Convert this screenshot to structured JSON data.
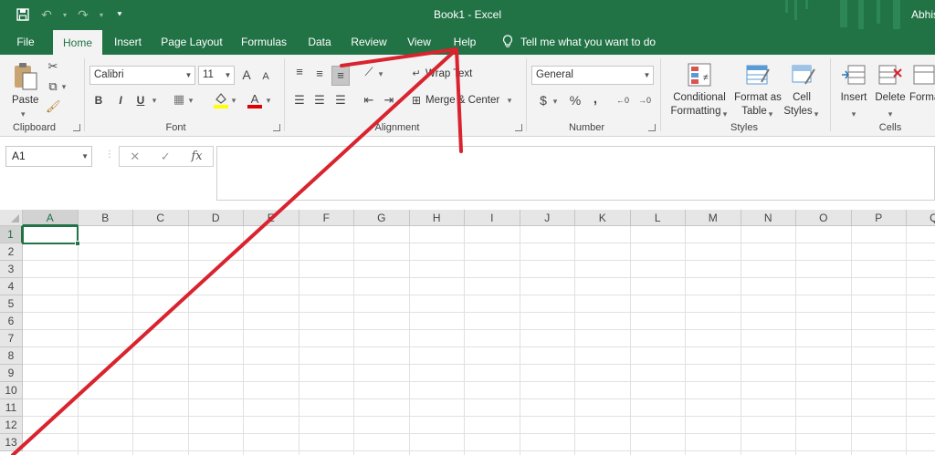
{
  "titlebar": {
    "doc_title": "Book1  -  Excel",
    "user": "Abhis",
    "qat": {
      "save_icon": "save-icon",
      "undo_icon": "undo-icon",
      "redo_icon": "redo-icon",
      "customize_icon": "customize-qat-icon"
    }
  },
  "tabs": [
    {
      "label": "File",
      "active": false
    },
    {
      "label": "Home",
      "active": true
    },
    {
      "label": "Insert",
      "active": false
    },
    {
      "label": "Page Layout",
      "active": false
    },
    {
      "label": "Formulas",
      "active": false
    },
    {
      "label": "Data",
      "active": false
    },
    {
      "label": "Review",
      "active": false
    },
    {
      "label": "View",
      "active": false
    },
    {
      "label": "Help",
      "active": false
    }
  ],
  "tell_me": "Tell me what you want to do",
  "ribbon": {
    "clipboard": {
      "label": "Clipboard",
      "paste": "Paste"
    },
    "font": {
      "label": "Font",
      "name": "Calibri",
      "size": "11",
      "bold": "B",
      "italic": "I",
      "underline": "U",
      "grow": "A",
      "shrink": "A",
      "font_color": "A"
    },
    "alignment": {
      "label": "Alignment",
      "wrap": "Wrap Text",
      "merge": "Merge & Center"
    },
    "number": {
      "label": "Number",
      "format": "General",
      "currency": "$",
      "percent": "%",
      "comma": ","
    },
    "styles": {
      "label": "Styles",
      "conditional_1": "Conditional",
      "conditional_2": "Formatting",
      "format_table_1": "Format as",
      "format_table_2": "Table",
      "cell_styles_1": "Cell",
      "cell_styles_2": "Styles"
    },
    "cells": {
      "label": "Cells",
      "insert": "Insert",
      "delete": "Delete",
      "format": "Format"
    }
  },
  "formula_bar": {
    "name_box": "A1",
    "cancel": "✕",
    "enter": "✓",
    "fx": "fx",
    "value": ""
  },
  "grid": {
    "columns": [
      "A",
      "B",
      "C",
      "D",
      "E",
      "F",
      "G",
      "H",
      "I",
      "J",
      "K",
      "L",
      "M",
      "N",
      "O",
      "P",
      "Q"
    ],
    "rows": [
      "1",
      "2",
      "3",
      "4",
      "5",
      "6",
      "7",
      "8",
      "9",
      "10",
      "11",
      "12",
      "13"
    ],
    "active_cell": "A1",
    "active_col": "A",
    "active_row": "1"
  },
  "colors": {
    "excel_green": "#217346",
    "ribbon_bg": "#f3f3f3",
    "annotation_red": "#d9232e"
  }
}
